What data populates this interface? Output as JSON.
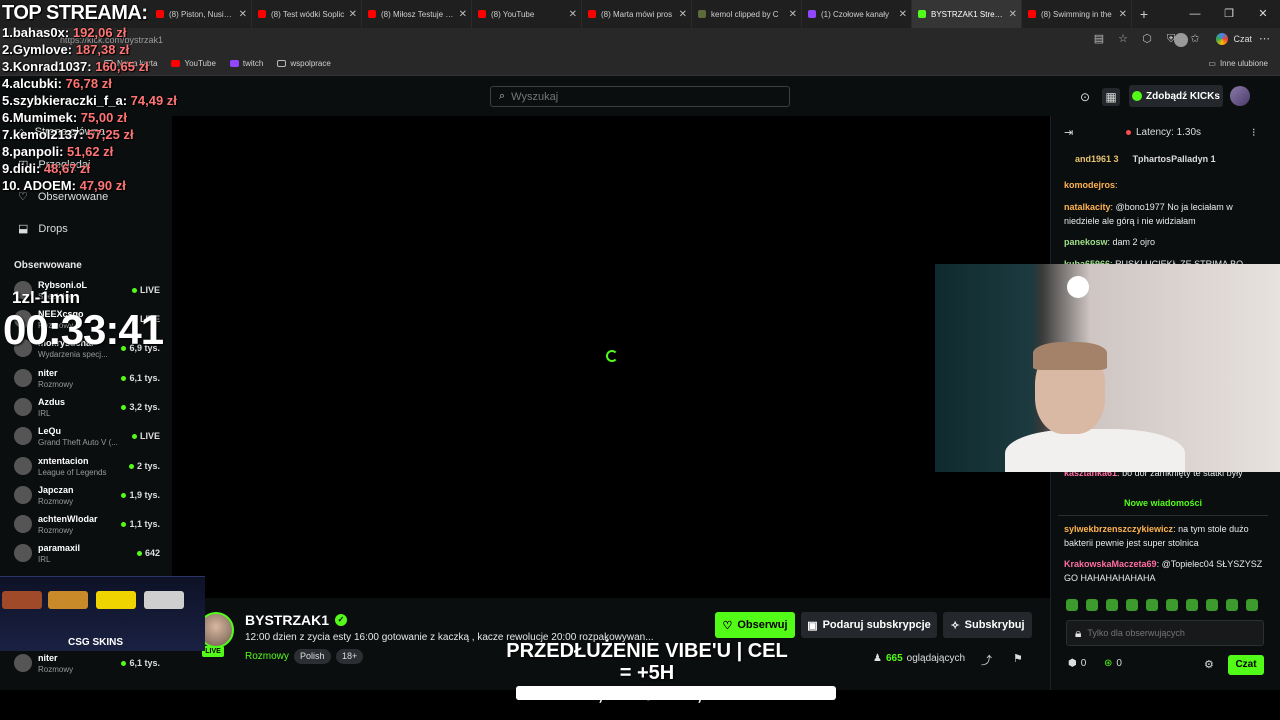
{
  "browser": {
    "tabs": [
      {
        "label": "(8) Piston, Nusiek i R",
        "fav": "yt"
      },
      {
        "label": "(8) Test wódki Soplic",
        "fav": "yt"
      },
      {
        "label": "(8) Miłosz Testuje - Y",
        "fav": "yt"
      },
      {
        "label": "(8) YouTube",
        "fav": "yt"
      },
      {
        "label": "(8) Marta mówi pros",
        "fav": "yt"
      },
      {
        "label": "kemol clipped by C",
        "fav": "c"
      },
      {
        "label": "(1) Czołowe kanały",
        "fav": "t"
      },
      {
        "label": "BYSTRZAK1 Stream",
        "fav": "k",
        "active": true
      },
      {
        "label": "(8) Swimming in the",
        "fav": "yt"
      }
    ],
    "url": "https://kick.com/bystrzak1",
    "chat_label": "Czat",
    "bookmarks": [
      "Nowa karta",
      "YouTube",
      "twitch",
      "wspolprace"
    ],
    "other_bookmarks": "Inne ulubione"
  },
  "header": {
    "search_placeholder": "Wyszukaj",
    "kicks_label": "Zdobądź KICKs"
  },
  "sidebar": {
    "nav": [
      "Strona główna",
      "Przeglądaj",
      "Obserwowane",
      "Drops"
    ],
    "section_title": "Obserwowane",
    "channels": [
      {
        "name": "Rybsoni.oL",
        "category": "Specjalne",
        "viewers": "LIVE"
      },
      {
        "name": "NEEXcsgo",
        "category": "Rozmowy",
        "viewers": "LIVE"
      },
      {
        "name": "mokrysuchar",
        "category": "Wydarzenia specj...",
        "viewers": "6,9 tys."
      },
      {
        "name": "niter",
        "category": "Rozmowy",
        "viewers": "6,1 tys."
      },
      {
        "name": "Azdus",
        "category": "IRL",
        "viewers": "3,2 tys."
      },
      {
        "name": "LeQu",
        "category": "Grand Theft Auto V (...",
        "viewers": "LIVE"
      },
      {
        "name": "xntentacion",
        "category": "League of Legends",
        "viewers": "2 tys."
      },
      {
        "name": "Japczan",
        "category": "Rozmowy",
        "viewers": "1,9 tys."
      },
      {
        "name": "achtenWlodar",
        "category": "Rozmowy",
        "viewers": "1,1 tys."
      },
      {
        "name": "paramaxil",
        "category": "IRL",
        "viewers": "642"
      },
      {
        "name": "niter",
        "category": "Rozmowy",
        "viewers": "6,1 tys."
      }
    ]
  },
  "stream": {
    "name": "BYSTRZAK1",
    "title": "12:00 dzien z zycia esty 16:00 gotowanie z kaczką , kacze rewolucje 20:00 rozpakowywan...",
    "category": "Rozmowy",
    "tags": [
      "Polish",
      "18+"
    ],
    "live_label": "LIVE",
    "follow_label": "Obserwuj",
    "gift_label": "Podaruj subskrypcje",
    "sub_label": "Subskrybuj",
    "viewers_count": "665",
    "viewers_label": "oglądających"
  },
  "chat": {
    "latency": "Latency: 1.30s",
    "gifters": [
      {
        "name": "and1961",
        "count": "3"
      },
      {
        "name": "TphartosPalladyn",
        "count": "1"
      }
    ],
    "messages": [
      {
        "user": "komodejros",
        "text": "",
        "color": "#ffb34d"
      },
      {
        "user": "natalkacity",
        "text": "@bono1977 No ja leciałam w niedziele ale górą i nie widziałam",
        "color": "#ffb34d"
      },
      {
        "user": "panekosw",
        "text": "dam 2 ojro",
        "color": "#9fe08a"
      },
      {
        "user": "kuba65966",
        "text": "RUSKI UCIEKŁ ZE STRIMA BO",
        "color": "#9fe08a"
      },
      {
        "user": "kasztanka61",
        "text": "bo dor zamknięty te statki były",
        "color": "#ff6fa0"
      },
      {
        "user": "sylwekbrzenszczykiewicz",
        "text": "na tym stole dużo bakterii pewnie jest super stolnica",
        "color": "#ffb34d"
      },
      {
        "user": "KrakowskaMaczeta69",
        "text": "@Topielec04 SŁYSZYSZ GO HAHAHAHAHAHA",
        "color": "#ff6fa0"
      }
    ],
    "new_messages": "Nowe wiadomości",
    "input_placeholder": "Tylko dla obserwujących",
    "kicks_count": "0",
    "points_count": "0",
    "send_label": "Czat"
  },
  "overlay": {
    "leaderboard_title": "TOP STREAMA:",
    "leaderboard": [
      {
        "rank": "1.",
        "name": "bahas0x",
        "amount": "192,06 zł"
      },
      {
        "rank": "2.",
        "name": "Gymlove",
        "amount": "187,38 zł"
      },
      {
        "rank": "3.",
        "name": "Konrad1037",
        "amount": "160,65 zł"
      },
      {
        "rank": "4.",
        "name": "alcubki",
        "amount": "76,78 zł"
      },
      {
        "rank": "5.",
        "name": "szybkieraczki_f_a",
        "amount": "74,49 zł"
      },
      {
        "rank": "6.",
        "name": "Mumimek",
        "amount": "75,00 zł"
      },
      {
        "rank": "7.",
        "name": "kemol2137",
        "amount": "57,25 zł"
      },
      {
        "rank": "8.",
        "name": "panpoli",
        "amount": "51,62 zł"
      },
      {
        "rank": "9.",
        "name": "didi",
        "amount": "48,67 zł"
      },
      {
        "rank": "10.",
        "name": "ADOEM",
        "amount": "47,90 zł"
      }
    ],
    "timer_label": "1zl-1min",
    "timer": "00:33:41",
    "csgo_brand": "CSG SKINS",
    "goal_title": "PRZEDŁUŻENIE VIBE'U | CEL = +5H",
    "goal_amount": "1 649,26 zł / 2000,00 zł",
    "goal_progress": 0.82
  }
}
